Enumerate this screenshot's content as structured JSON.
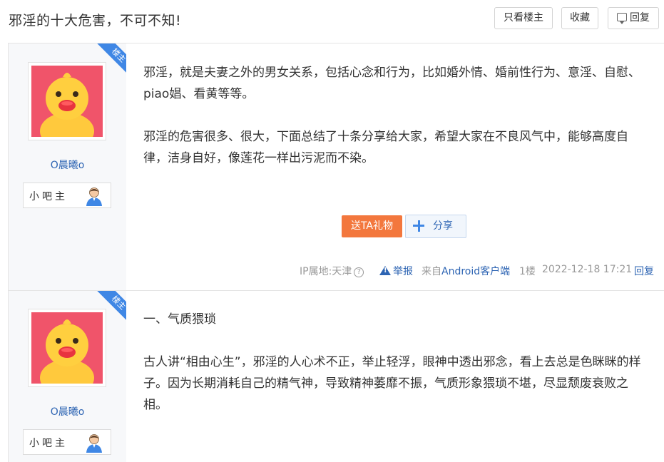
{
  "thread": {
    "title": "邪淫的十大危害，不可不知!",
    "buttons": {
      "only_op": "只看楼主",
      "favorite": "收藏",
      "reply": "回复"
    }
  },
  "posts": [
    {
      "badge": "楼主",
      "username": "O晨曦o",
      "rank": "小吧主",
      "paragraphs": [
        "邪淫，就是夫妻之外的男女关系，包括心念和行为，比如婚外情、婚前性行为、意淫、自慰、piao娼、看黄等等。",
        "邪淫的危害很多、很大，下面总结了十条分享给大家，希望大家在不良风气中，能够高度自律，洁身自好，像莲花一样出污泥而不染。"
      ],
      "gift_label": "送TA礼物",
      "share_label": "分享",
      "meta": {
        "ip": "IP属地:天津",
        "help": "?",
        "report": "举报",
        "from_prefix": "来自",
        "client": "Android客户端",
        "floor": "1楼",
        "time": "2022-12-18 17:21",
        "reply": "回复"
      }
    },
    {
      "badge": "楼主",
      "username": "O晨曦o",
      "rank": "小吧主",
      "paragraphs": [
        "一、气质猥琐",
        "古人讲“相由心生”，邪淫的人心术不正，举止轻浮，眼神中透出邪念，看上去总是色眯眯的样子。因为长期消耗自己的精气神，导致精神萎靡不振，气质形象猥琐不堪，尽显颓废衰败之相。"
      ]
    }
  ]
}
